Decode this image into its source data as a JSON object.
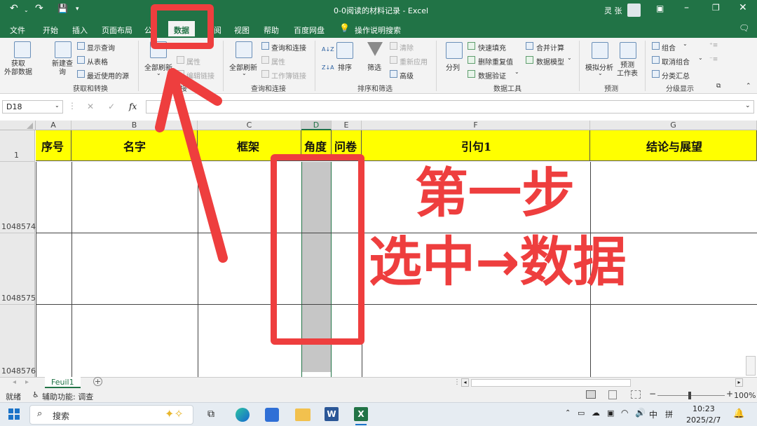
{
  "window": {
    "title": "0-0阅读的材料记录  -  Excel",
    "user": "灵 张"
  },
  "ribbon_tabs": [
    "文件",
    "开始",
    "插入",
    "页面布局",
    "公",
    "数据",
    "阅",
    "视图",
    "帮助",
    "百度网盘"
  ],
  "active_tab": "数据",
  "tell_me": "操作说明搜索",
  "ribbon": {
    "get_data": "获取\n外部数据",
    "new_query": "新建查\n询",
    "show_query": "显示查询",
    "from_table": "从表格",
    "recent_sources": "最近使用的源",
    "group_get_transform": "获取和转换",
    "refresh_all": "全部刷新",
    "properties": "属性",
    "edit_links": "编辑链接",
    "group_connections": "连接",
    "refresh_all2": "全部刷新",
    "queries_connections": "查询和连接",
    "properties2": "属性",
    "workbook_links": "工作簿链接",
    "group_queries": "查询和连接",
    "sort_asc": "A↓Z",
    "sort_desc": "Z↓A",
    "sort": "排序",
    "filter": "筛选",
    "clear": "清除",
    "reapply": "重新应用",
    "advanced": "高级",
    "group_sort_filter": "排序和筛选",
    "split": "分列",
    "flash_fill": "快速填充",
    "remove_dup": "删除重复值",
    "data_validation": "数据验证",
    "consolidate": "合并计算",
    "data_model": "数据模型",
    "group_data_tools": "数据工具",
    "what_if": "模拟分析",
    "forecast": "预测\n工作表",
    "group_forecast": "预测",
    "group_btn": "组合",
    "ungroup": "取消组合",
    "subtotal": "分类汇总",
    "group_outline": "分级显示"
  },
  "formula_bar": {
    "name_box": "D18",
    "fx": "fx",
    "value": ""
  },
  "columns": [
    "A",
    "B",
    "C",
    "D",
    "E",
    "F",
    "G"
  ],
  "selected_column": "D",
  "header_row_number": "1",
  "header_cells": [
    "序号",
    "名字",
    "框架",
    "角度",
    "问卷",
    "引句1",
    "结论与展望"
  ],
  "rows": [
    "1048574",
    "1048575",
    "1048576"
  ],
  "sheet_tab": "Feuil1",
  "status": {
    "ready": "就绪",
    "accessibility": "辅助功能: 调查",
    "zoom": "100%"
  },
  "taskbar": {
    "search": "搜索",
    "ime": "中",
    "ime2": "拼",
    "time": "10:23",
    "date": "2025/2/7"
  },
  "annotation": {
    "step": "第一步",
    "instruction": "选中→数据"
  },
  "colors": {
    "excel_green": "#217346",
    "header_fill": "#ffff00",
    "annotation_red": "#ee3e3e"
  }
}
